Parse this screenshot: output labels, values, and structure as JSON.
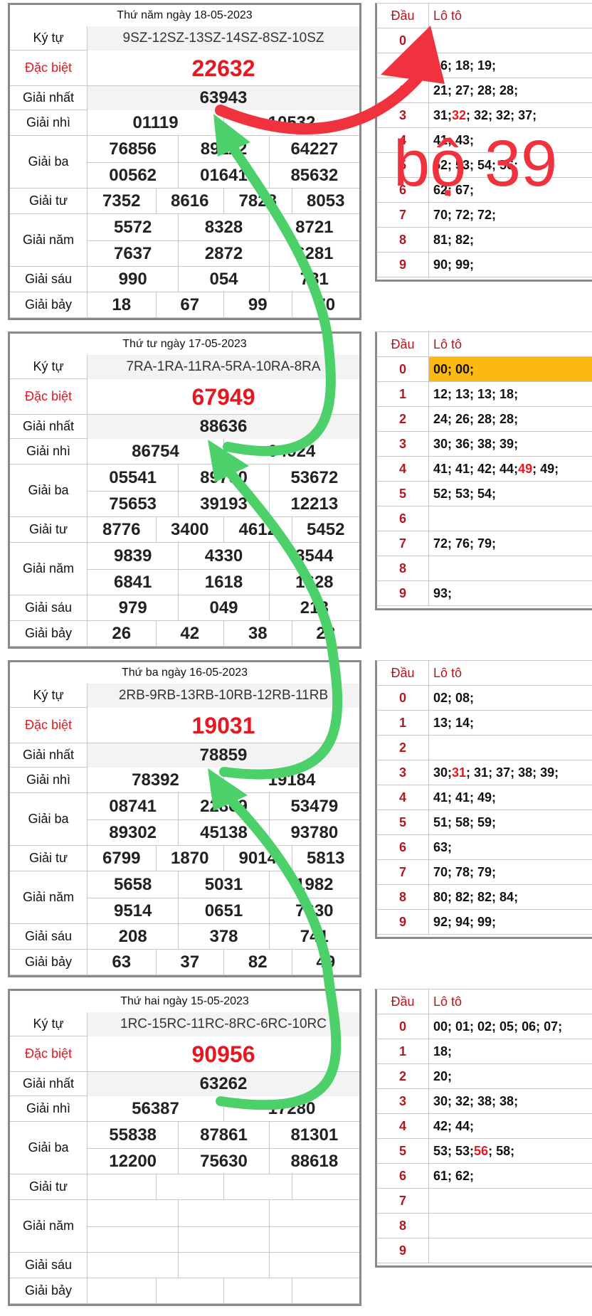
{
  "days": [
    {
      "title": "Thứ năm ngày 18-05-2023",
      "ky_tu": "9SZ-12SZ-13SZ-14SZ-8SZ-10SZ",
      "dac_biet": "22632",
      "giai_nhat": "63943",
      "giai_nhi": [
        "01119",
        "10532"
      ],
      "giai_ba": [
        "76856",
        "89112",
        "64227",
        "00562",
        "01641",
        "85632"
      ],
      "giai_tu": [
        "7352",
        "8616",
        "7828",
        "8053"
      ],
      "giai_nam": [
        "5572",
        "8328",
        "8721",
        "7637",
        "2872",
        "6281"
      ],
      "giai_sau": [
        "990",
        "054",
        "731"
      ],
      "giai_bay": [
        "18",
        "67",
        "99",
        "70"
      ],
      "loto": [
        [
          {
            "t": ""
          }
        ],
        [
          {
            "t": "16; 18; 19;"
          }
        ],
        [
          {
            "t": "21; 27; 28; 28;"
          }
        ],
        [
          {
            "t": "31; "
          },
          {
            "t": "32",
            "red": true
          },
          {
            "t": "; 32; 32; 37;"
          }
        ],
        [
          {
            "t": "41; 43;"
          }
        ],
        [
          {
            "t": "52; 53; 54; 56;"
          }
        ],
        [
          {
            "t": "62; 67;"
          }
        ],
        [
          {
            "t": "70; 72; 72;"
          }
        ],
        [
          {
            "t": "81; 82;"
          }
        ],
        [
          {
            "t": "90; 99;"
          }
        ]
      ]
    },
    {
      "title": "Thứ tư ngày 17-05-2023",
      "ky_tu": "7RA-1RA-11RA-5RA-10RA-8RA",
      "dac_biet": "67949",
      "giai_nhat": "88636",
      "giai_nhi": [
        "86754",
        "04924"
      ],
      "giai_ba": [
        "05541",
        "89700",
        "53672",
        "75653",
        "39193",
        "12213"
      ],
      "giai_tu": [
        "8776",
        "3400",
        "4612",
        "5452"
      ],
      "giai_nam": [
        "9839",
        "4330",
        "3544",
        "6841",
        "1618",
        "1628"
      ],
      "giai_sau": [
        "979",
        "049",
        "213"
      ],
      "giai_bay": [
        "26",
        "42",
        "38",
        "28"
      ],
      "loto_highlight_row": 0,
      "loto": [
        [
          {
            "t": "00; 00;"
          }
        ],
        [
          {
            "t": "12; 13; 13; 18;"
          }
        ],
        [
          {
            "t": "24; 26; 28; 28;"
          }
        ],
        [
          {
            "t": "30; 36; 38; 39;"
          }
        ],
        [
          {
            "t": "41; 41; 42; 44; "
          },
          {
            "t": "49",
            "red": true
          },
          {
            "t": "; 49;"
          }
        ],
        [
          {
            "t": "52; 53; 54;"
          }
        ],
        [
          {
            "t": ""
          }
        ],
        [
          {
            "t": "72; 76; 79;"
          }
        ],
        [
          {
            "t": ""
          }
        ],
        [
          {
            "t": "93;"
          }
        ]
      ]
    },
    {
      "title": "Thứ ba ngày 16-05-2023",
      "ky_tu": "2RB-9RB-13RB-10RB-12RB-11RB",
      "dac_biet": "19031",
      "giai_nhat": "78859",
      "giai_nhi": [
        "78392",
        "19184"
      ],
      "giai_ba": [
        "08741",
        "22869",
        "53479",
        "89302",
        "45138",
        "93780"
      ],
      "giai_tu": [
        "6799",
        "1870",
        "9014",
        "5813"
      ],
      "giai_nam": [
        "5658",
        "5031",
        "1982",
        "9514",
        "0651",
        "7630"
      ],
      "giai_sau": [
        "208",
        "378",
        "741"
      ],
      "giai_bay": [
        "63",
        "37",
        "82",
        "49"
      ],
      "loto": [
        [
          {
            "t": "02; 08;"
          }
        ],
        [
          {
            "t": "13; 14;"
          }
        ],
        [
          {
            "t": ""
          }
        ],
        [
          {
            "t": "30; "
          },
          {
            "t": "31",
            "red": true
          },
          {
            "t": "; 31; 37; 38; 39;"
          }
        ],
        [
          {
            "t": "41; 41; 49;"
          }
        ],
        [
          {
            "t": "51; 58; 59;"
          }
        ],
        [
          {
            "t": "63;"
          }
        ],
        [
          {
            "t": "70; 78; 79;"
          }
        ],
        [
          {
            "t": "80; 82; 82; 84;"
          }
        ],
        [
          {
            "t": "92; 94; 99;"
          }
        ]
      ]
    },
    {
      "title": "Thứ hai ngày 15-05-2023",
      "ky_tu": "1RC-15RC-11RC-8RC-6RC-10RC",
      "dac_biet": "90956",
      "giai_nhat": "63262",
      "giai_nhi": [
        "56387",
        "17280"
      ],
      "giai_ba": [
        "55838",
        "87861",
        "81301",
        "12200",
        "75630",
        "88618"
      ],
      "giai_tu": [
        "",
        "",
        "",
        ""
      ],
      "giai_nam": [
        "",
        "",
        "",
        "",
        "",
        ""
      ],
      "giai_sau": [
        "",
        "",
        ""
      ],
      "giai_bay": [
        "",
        "",
        "",
        ""
      ],
      "loto": [
        [
          {
            "t": "00; 01; 02; 05; 06; 07;"
          }
        ],
        [
          {
            "t": "18;"
          }
        ],
        [
          {
            "t": "20;"
          }
        ],
        [
          {
            "t": "30; 32; 38; 38;"
          }
        ],
        [
          {
            "t": "42; 44;"
          }
        ],
        [
          {
            "t": "53; 53; "
          },
          {
            "t": "56",
            "red": true
          },
          {
            "t": "; 58;"
          }
        ],
        [
          {
            "t": "61; 62;"
          }
        ],
        [
          {
            "t": ""
          }
        ],
        [
          {
            "t": ""
          }
        ],
        [
          {
            "t": ""
          }
        ]
      ]
    }
  ],
  "labels": {
    "ky_tu": "Ký tự",
    "dac_biet": "Đặc biệt",
    "giai_nhat": "Giải nhất",
    "giai_nhi": "Giải nhì",
    "giai_ba": "Giải ba",
    "giai_tu": "Giải tư",
    "giai_nam": "Giải năm",
    "giai_sau": "Giải sáu",
    "giai_bay": "Giải bảy",
    "dau": "Đầu",
    "loto": "Lô tô"
  },
  "dau_digits": [
    "0",
    "1",
    "2",
    "3",
    "4",
    "5",
    "6",
    "7",
    "8",
    "9"
  ],
  "annotation": "bộ 39",
  "colors": {
    "red_arrow": "#f0323f",
    "green_arrow": "#4cd06a",
    "highlight": "#fdb913"
  }
}
